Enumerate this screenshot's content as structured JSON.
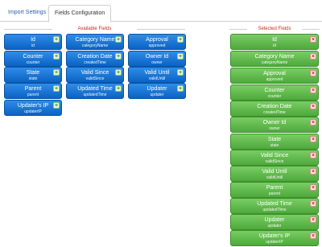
{
  "tabs": [
    {
      "label": "Import Settings"
    },
    {
      "label": "Fields Configuration"
    }
  ],
  "available": {
    "title": "Available Fields",
    "add_symbol": "+",
    "fields": [
      {
        "label": "Id",
        "key": "id"
      },
      {
        "label": "Category Name",
        "key": "categoryName"
      },
      {
        "label": "Approval",
        "key": "approved"
      },
      {
        "label": "Counter",
        "key": "counter"
      },
      {
        "label": "Creation Date",
        "key": "createdTime"
      },
      {
        "label": "Owner Id",
        "key": "owner"
      },
      {
        "label": "State",
        "key": "state"
      },
      {
        "label": "Valid Since",
        "key": "validSince"
      },
      {
        "label": "Valid Until",
        "key": "validUntil"
      },
      {
        "label": "Parent",
        "key": "parent"
      },
      {
        "label": "Updated Time",
        "key": "updatedTime"
      },
      {
        "label": "Updater",
        "key": "updater"
      },
      {
        "label": "Updater's IP",
        "key": "updaterIP"
      }
    ]
  },
  "selected": {
    "title": "Selected Fields",
    "remove_symbol": "×",
    "fields": [
      {
        "label": "Id",
        "key": "id"
      },
      {
        "label": "Category Name",
        "key": "categoryName"
      },
      {
        "label": "Approval",
        "key": "approved"
      },
      {
        "label": "Counter",
        "key": "counter"
      },
      {
        "label": "Creation Date",
        "key": "createdTime"
      },
      {
        "label": "Owner Id",
        "key": "owner"
      },
      {
        "label": "State",
        "key": "state"
      },
      {
        "label": "Valid Since",
        "key": "validSince"
      },
      {
        "label": "Valid Until",
        "key": "validUntil"
      },
      {
        "label": "Parent",
        "key": "parent"
      },
      {
        "label": "Updated Time",
        "key": "updatedTime"
      },
      {
        "label": "Updater",
        "key": "updater"
      },
      {
        "label": "Updater's IP",
        "key": "updaterIP"
      }
    ]
  }
}
